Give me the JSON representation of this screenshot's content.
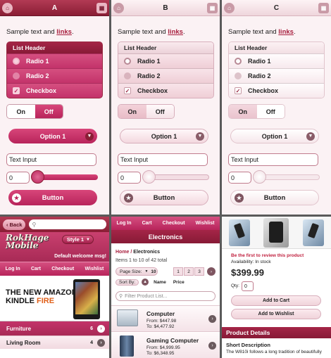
{
  "themes": [
    {
      "title": "A",
      "sample": "Sample text and ",
      "link": "links",
      "period": ".",
      "list_header": "List Header",
      "radio1": "Radio 1",
      "radio2": "Radio 2",
      "checkbox": "Checkbox",
      "on": "On",
      "off": "Off",
      "option": "Option 1",
      "text_input": "Text Input",
      "slider_value": "0",
      "button": "Button",
      "slider_level": 0
    },
    {
      "title": "B",
      "sample": "Sample text and ",
      "link": "links",
      "period": ".",
      "list_header": "List Header",
      "radio1": "Radio 1",
      "radio2": "Radio 2",
      "checkbox": "Checkbox",
      "on": "On",
      "off": "Off",
      "option": "Option 1",
      "text_input": "Text Input",
      "slider_value": "0",
      "button": "Button",
      "slider_level": 0
    },
    {
      "title": "C",
      "sample": "Sample text and ",
      "link": "links",
      "period": ".",
      "list_header": "List Header",
      "radio1": "Radio 1",
      "radio2": "Radio 2",
      "checkbox": "Checkbox",
      "on": "On",
      "off": "Off",
      "option": "Option 1",
      "text_input": "Text Input",
      "slider_value": "0",
      "button": "Button",
      "slider_level": 0
    }
  ],
  "icons": {
    "home": "home-icon",
    "menu": "grid-icon",
    "star": "star-icon",
    "chevron": "chevron-down-icon"
  },
  "colors": {
    "accent": "#b8245b",
    "header_dark": "#8a1e35",
    "link": "#a81f3e"
  },
  "store": {
    "back": "Back",
    "logo_line1": "RokHage",
    "logo_line2": "Mobile",
    "style_select": "Style 1",
    "welcome": "Default welcome msg!",
    "nav": [
      "Log In",
      "Cart",
      "Checkout",
      "Wishlist"
    ],
    "banner_line1": "THE NEW AMAZON",
    "banner_line2": "KINDLE ",
    "banner_fire": "FIRE",
    "categories": [
      {
        "name": "Furniture",
        "count": "6"
      },
      {
        "name": "Living Room",
        "count": "4"
      }
    ]
  },
  "catalog": {
    "nav": [
      "Log In",
      "Cart",
      "Checkout",
      "Wishlist"
    ],
    "title": "Electronics",
    "crumb_home": "Home",
    "crumb_sep": " / ",
    "crumb_current": "Electronics",
    "items_info": "Items 1 to 10 of 42 total",
    "page_size_label": "Page Size:",
    "page_size": "10",
    "pages": [
      "1",
      "2",
      "3"
    ],
    "sort_label": "Sort By:",
    "sort_name": "Name",
    "sort_price": "Price",
    "filter_placeholder": "Filter Product List...",
    "products": [
      {
        "name": "Computer",
        "from": "From: $447.98",
        "to": "To: $4,477.92"
      },
      {
        "name": "Gaming Computer",
        "from": "From: $4,999.95",
        "to": "To: $6,348.95"
      }
    ]
  },
  "product": {
    "review": "Be the first to review this product",
    "availability": "Availability: In stock",
    "price": "$399.99",
    "qty_label": "Qty:",
    "qty": "0",
    "add_cart": "Add to Cart",
    "add_wishlist": "Add to Wishlist",
    "details_title": "Product Details",
    "short_desc_title": "Short Description",
    "short_desc": "The W810i follows a long tradition of beautifully"
  }
}
